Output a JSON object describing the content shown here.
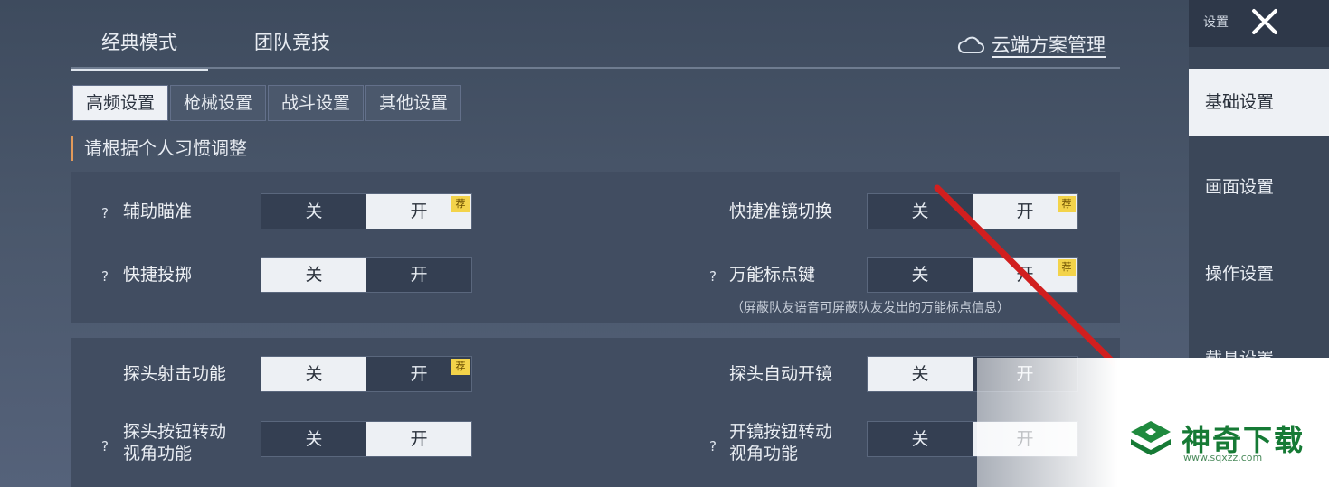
{
  "mode_tabs": [
    {
      "label": "经典模式",
      "active": true
    },
    {
      "label": "团队竞技",
      "active": false
    }
  ],
  "cloud_link": "云端方案管理",
  "sub_tabs": [
    {
      "label": "高频设置",
      "active": true
    },
    {
      "label": "枪械设置",
      "active": false
    },
    {
      "label": "战斗设置",
      "active": false
    },
    {
      "label": "其他设置",
      "active": false
    }
  ],
  "hint": "请根据个人习惯调整",
  "toggle": {
    "off": "关",
    "on": "开",
    "recommend_tag": "荐"
  },
  "settings": {
    "aim_assist": {
      "label": "辅助瞄准",
      "value": "开"
    },
    "scope_switch": {
      "label": "快捷准镜切换",
      "value": "开"
    },
    "quick_throw": {
      "label": "快捷投掷",
      "value": "关"
    },
    "universal_mark": {
      "label": "万能标点键",
      "value": "开"
    },
    "mark_note": "（屏蔽队友语音可屏蔽队友发出的万能标点信息）",
    "peek_fire": {
      "label": "探头射击功能",
      "value": "关"
    },
    "peek_auto_scope": {
      "label": "探头自动开镜",
      "value": "关"
    },
    "peek_btn_view_line1": "探头按钮转动",
    "peek_btn_view_line2": "视角功能",
    "peek_btn_view_value": "开",
    "scope_btn_view_line1": "开镜按钮转动",
    "scope_btn_view_line2": "视角功能",
    "scope_btn_view_value": "开"
  },
  "sidebar": {
    "title": "设置",
    "items": [
      {
        "label": "基础设置",
        "active": true
      },
      {
        "label": "画面设置",
        "active": false
      },
      {
        "label": "操作设置",
        "active": false
      },
      {
        "label": "载具设置",
        "active": false
      }
    ]
  },
  "watermark": {
    "brand": "神奇下载",
    "url": "www.sqxzz.com"
  },
  "colors": {
    "accent_line": "#e29a5a",
    "tag": "#f3d34a",
    "arrow": "#d11f1f",
    "brand": "#167a35"
  }
}
